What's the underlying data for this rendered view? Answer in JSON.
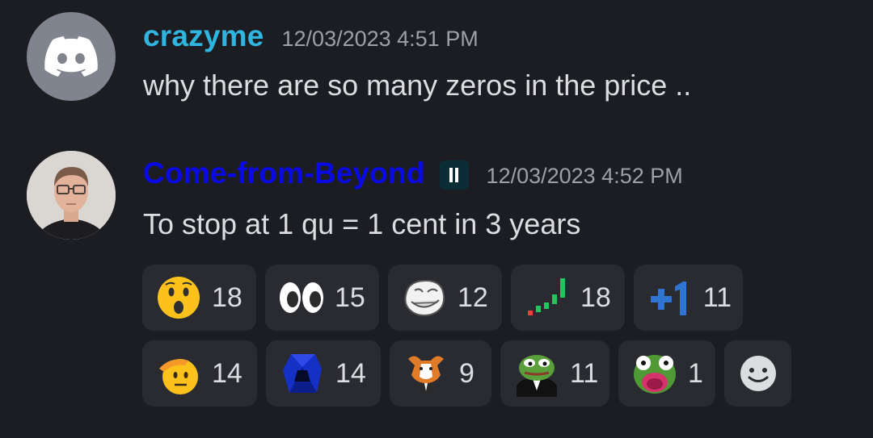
{
  "messages": [
    {
      "username": "crazyme",
      "username_color": "#2fb5e0",
      "timestamp": "12/03/2023 4:51 PM",
      "text": "why there are so many zeros in the price ..",
      "avatar_icon": "discord-logo-icon"
    },
    {
      "username": "Come-from-Beyond",
      "username_color": "#0a0ae6",
      "timestamp": "12/03/2023 4:52 PM",
      "text": "To stop at 1 qu = 1 cent in 3 years",
      "badge_icon": "server-tag-icon",
      "avatar_icon": "user-photo"
    }
  ],
  "reactions": {
    "row1": [
      {
        "emoji": "hushed-face-emoji",
        "count": "18"
      },
      {
        "emoji": "eyes-emoji",
        "count": "15"
      },
      {
        "emoji": "troll-face-emoji",
        "count": "12"
      },
      {
        "emoji": "stock-chart-emoji",
        "count": "18"
      },
      {
        "emoji": "plus-one-emoji",
        "count": "11"
      }
    ],
    "row2": [
      {
        "emoji": "saluting-face-emoji",
        "count": "14"
      },
      {
        "emoji": "blue-crystal-emoji",
        "count": "14"
      },
      {
        "emoji": "dancing-cow-emoji",
        "count": "9"
      },
      {
        "emoji": "pepe-suit-emoji",
        "count": "11"
      },
      {
        "emoji": "pepe-shocked-emoji",
        "count": "1"
      }
    ],
    "add_reaction_icon": "add-reaction-icon"
  }
}
